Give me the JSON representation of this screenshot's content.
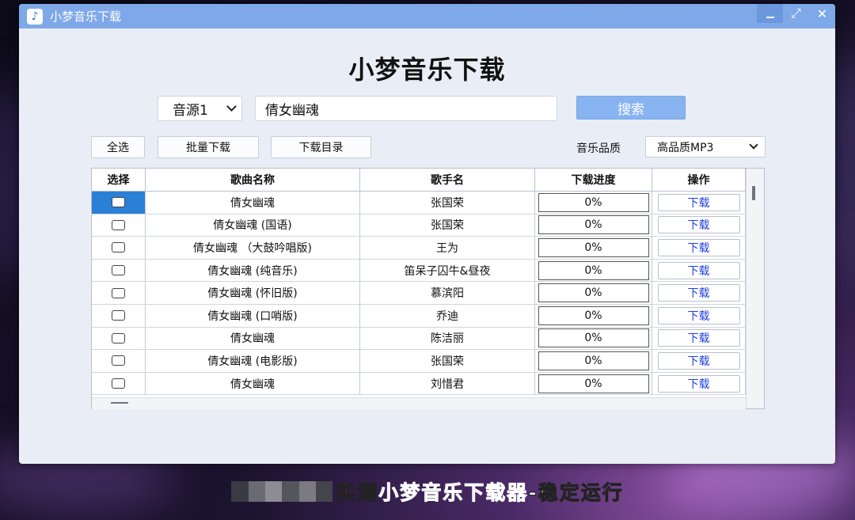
{
  "window": {
    "title": "小梦音乐下载",
    "app_icon": "music-note-icon"
  },
  "heading": "小梦音乐下载",
  "search": {
    "source_selected": "音源1",
    "query": "倩女幽魂",
    "button_label": "搜索"
  },
  "toolbar": {
    "select_all": "全选",
    "batch_download": "批量下载",
    "download_dir": "下载目录",
    "quality_label": "音乐品质",
    "quality_selected": "高品质MP3"
  },
  "table": {
    "headers": [
      "选择",
      "歌曲名称",
      "歌手名",
      "下载进度",
      "操作"
    ],
    "rows": [
      {
        "song": "倩女幽魂",
        "artist": "张国荣",
        "progress": "0%",
        "action": "下载",
        "selected": true
      },
      {
        "song": "倩女幽魂 (国语)",
        "artist": "张国荣",
        "progress": "0%",
        "action": "下载",
        "selected": false
      },
      {
        "song": "倩女幽魂 （大鼓吟唱版)",
        "artist": "王为",
        "progress": "0%",
        "action": "下载",
        "selected": false
      },
      {
        "song": "倩女幽魂 (纯音乐)",
        "artist": "笛呆子囚牛&昼夜",
        "progress": "0%",
        "action": "下载",
        "selected": false
      },
      {
        "song": "倩女幽魂 (怀旧版)",
        "artist": "慕滨阳",
        "progress": "0%",
        "action": "下载",
        "selected": false
      },
      {
        "song": "倩女幽魂 (口哨版)",
        "artist": "乔迪",
        "progress": "0%",
        "action": "下载",
        "selected": false
      },
      {
        "song": "倩女幽魂",
        "artist": "陈洁丽",
        "progress": "0%",
        "action": "下载",
        "selected": false
      },
      {
        "song": "倩女幽魂 (电影版)",
        "artist": "张国荣",
        "progress": "0%",
        "action": "下载",
        "selected": false
      },
      {
        "song": "倩女幽魂",
        "artist": "刘惜君",
        "progress": "0%",
        "action": "下载",
        "selected": false
      }
    ]
  },
  "caption": {
    "part1": "实测",
    "part2": "小梦音乐下载器",
    "part3": "-稳定运行"
  },
  "colors": {
    "titlebar": "#7ea8e8",
    "accent_button": "#87b3f0",
    "selection": "#2a7fd6",
    "link_blue": "#1f3ee0",
    "caption_red": "#e8101a"
  }
}
